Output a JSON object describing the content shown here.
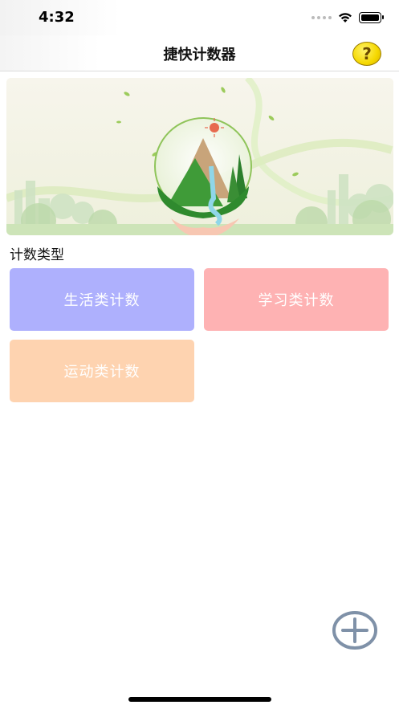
{
  "status_bar": {
    "time": "4:32"
  },
  "nav": {
    "title": "捷快计数器",
    "help_icon": "?"
  },
  "section": {
    "title": "计数类型"
  },
  "categories": [
    {
      "label": "生活类计数",
      "color": "#aeb0fd"
    },
    {
      "label": "学习类计数",
      "color": "#feb2b3"
    },
    {
      "label": "运动类计数",
      "color": "#fed3b0"
    }
  ],
  "fab": {
    "icon": "plus-circle-icon"
  }
}
